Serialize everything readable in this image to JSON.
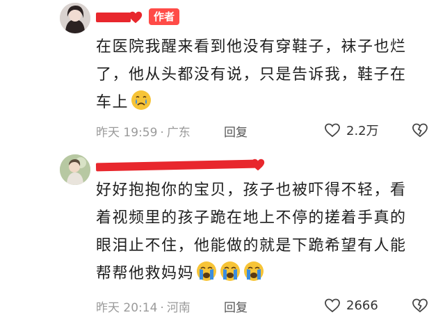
{
  "comments": [
    {
      "author_badge": "作者",
      "lines": [
        "在医院我醒来看到他没有穿鞋子，袜子也烂",
        "了，他从头都没有说，只是告诉我，鞋子在",
        "车上"
      ],
      "emoji": [
        "crying-face"
      ],
      "time": "昨天 19:59",
      "location": "广东",
      "reply_label": "回复",
      "likes": "2.2万"
    },
    {
      "lines": [
        "好好抱抱你的宝贝，孩子也被吓得不轻，看",
        "着视频里的孩子跪在地上不停的搓着手真的",
        "眼泪止不住，他能做的就是下跪希望有人能",
        "帮帮他救妈妈"
      ],
      "emoji": [
        "loudly-crying-face",
        "loudly-crying-face",
        "loudly-crying-face"
      ],
      "time": "昨天 20:14",
      "location": "河南",
      "reply_label": "回复",
      "likes": "2666"
    }
  ],
  "colors": {
    "author_badge_bg": "#ff4b47",
    "heart": "#e8272d",
    "meta_text": "#9a9a9a",
    "emoji_yellow": "#f7c437",
    "tear_blue": "#3a8de0"
  }
}
